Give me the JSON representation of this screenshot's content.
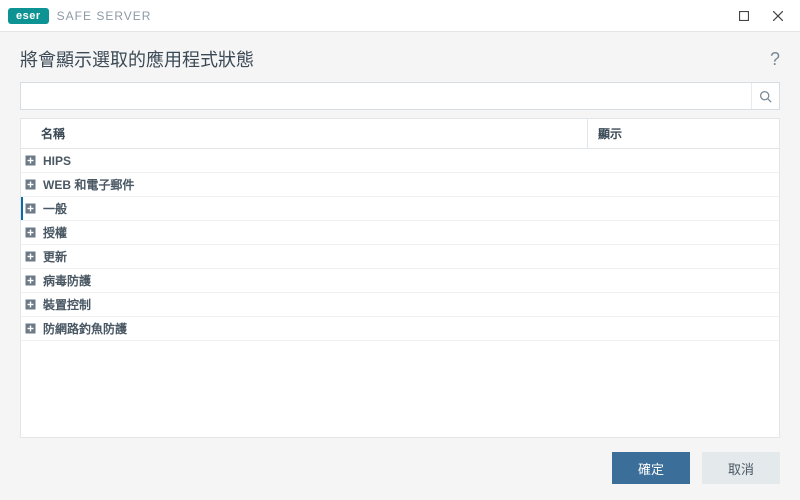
{
  "brand": {
    "badge": "eser",
    "product": "SAFE SERVER"
  },
  "page": {
    "title": "將會顯示選取的應用程式狀態"
  },
  "help": {
    "label": "?"
  },
  "search": {
    "placeholder": "",
    "value": ""
  },
  "columns": {
    "name": "名稱",
    "display": "顯示"
  },
  "rows": [
    {
      "label": "HIPS"
    },
    {
      "label": "WEB 和電子郵件"
    },
    {
      "label": "一般",
      "selected": true
    },
    {
      "label": "授權"
    },
    {
      "label": "更新"
    },
    {
      "label": "病毒防護"
    },
    {
      "label": "裝置控制"
    },
    {
      "label": "防網路釣魚防護"
    }
  ],
  "buttons": {
    "ok": "確定",
    "cancel": "取消"
  }
}
